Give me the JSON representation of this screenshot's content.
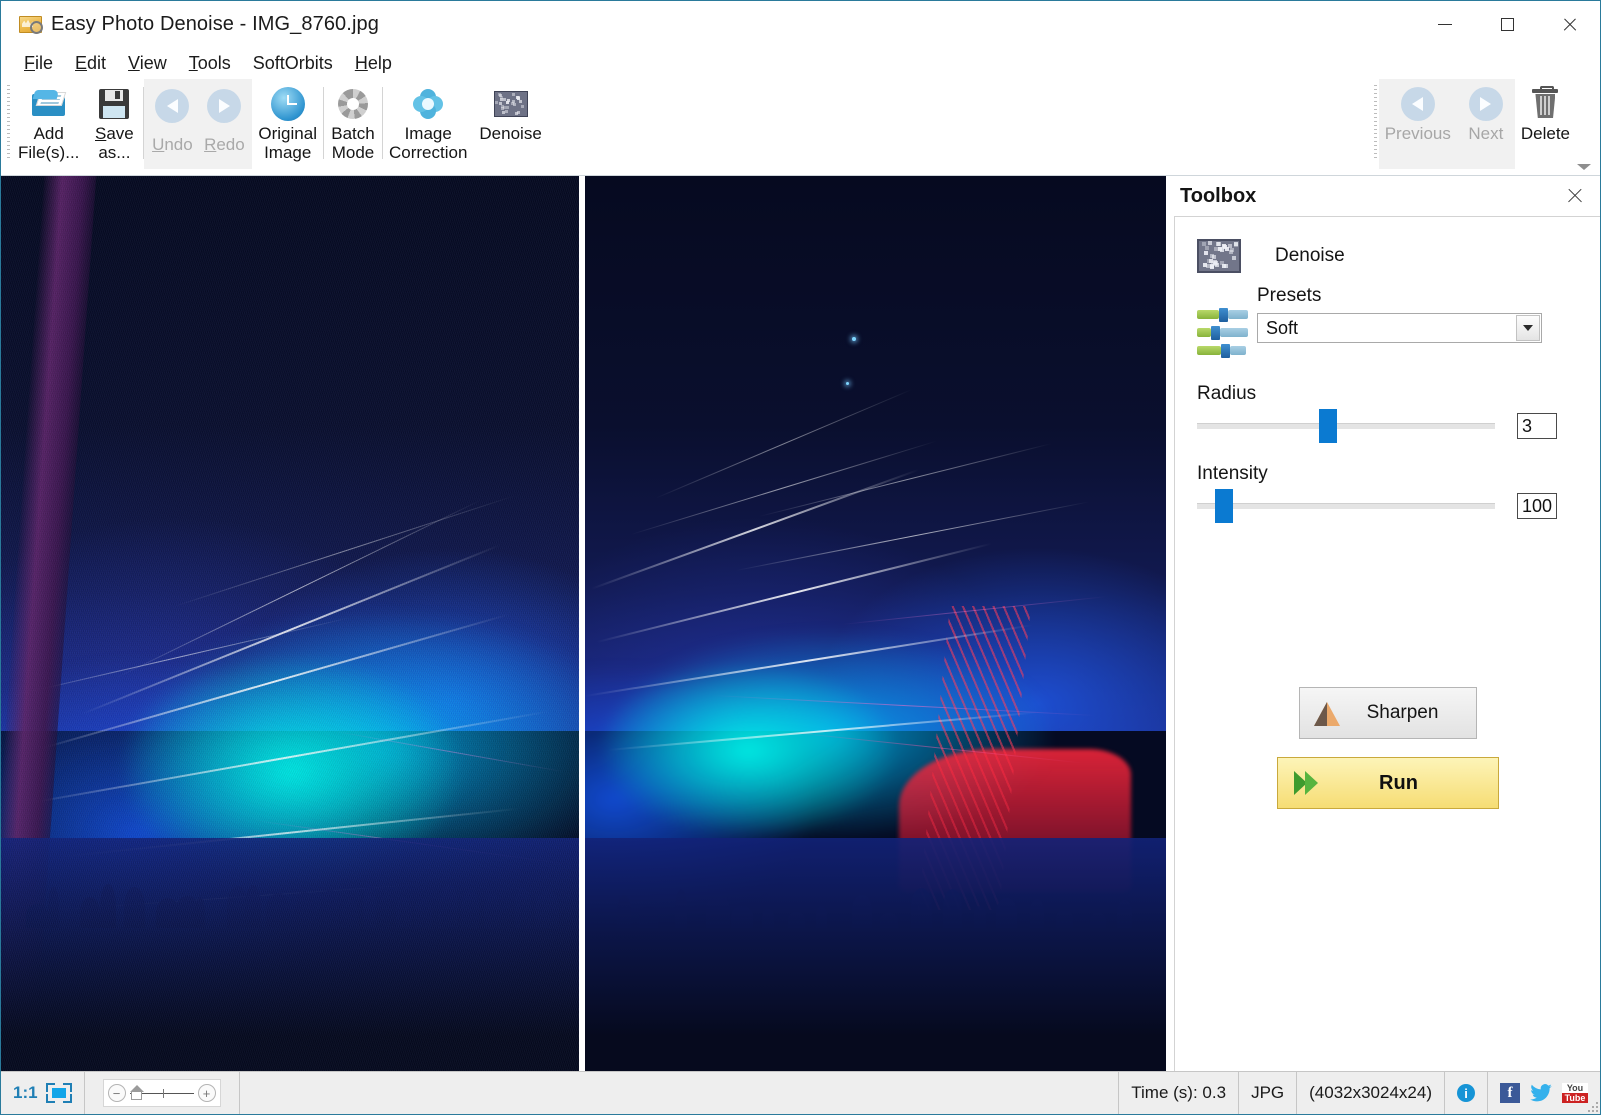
{
  "window": {
    "title": "Easy Photo Denoise - IMG_8760.jpg",
    "app_icon": "photo-frame-icon",
    "minimize": "minimize",
    "maximize": "maximize",
    "close": "close"
  },
  "menu": {
    "items": [
      {
        "label": "File",
        "accel": "F"
      },
      {
        "label": "Edit",
        "accel": "E"
      },
      {
        "label": "View",
        "accel": "V"
      },
      {
        "label": "Tools",
        "accel": "T"
      },
      {
        "label": "SoftOrbits",
        "accel": ""
      },
      {
        "label": "Help",
        "accel": "H"
      }
    ]
  },
  "toolbar": {
    "add_files": "Add\nFile(s)...",
    "save_as": "Save\nas...",
    "undo": "Undo",
    "redo": "Redo",
    "original_image": "Original\nImage",
    "batch_mode": "Batch\nMode",
    "image_correction": "Image\nCorrection",
    "denoise": "Denoise",
    "previous": "Previous",
    "next": "Next",
    "delete": "Delete",
    "overflow": "more-commands"
  },
  "toolbox": {
    "title": "Toolbox",
    "tool_name": "Denoise",
    "presets_label": "Presets",
    "preset_value": "Soft",
    "preset_options": [
      "Soft"
    ],
    "radius_label": "Radius",
    "radius_value": "3",
    "radius_percent": 41,
    "intensity_label": "Intensity",
    "intensity_value": "100",
    "intensity_percent": 6,
    "sharpen_button": "Sharpen",
    "run_button": "Run"
  },
  "statusbar": {
    "zoom_ratio": "1:1",
    "fit_icon": "fit-to-window-icon",
    "zoom_out": "−",
    "zoom_in": "+",
    "time": "Time (s): 0.3",
    "format": "JPG",
    "dimensions": "(4032x3024x24)",
    "info_icon": "i",
    "facebook": "f",
    "twitter": "twitter-icon",
    "youtube_top": "You",
    "youtube_bottom": "Tube"
  },
  "colors": {
    "accent_blue": "#0b7ad1",
    "run_yellow": "#f6dd74",
    "title_border": "#2a7a9b",
    "status_bg": "#eeeeee"
  },
  "image_panes": {
    "left_label": "original-noisy-preview",
    "right_label": "denoised-preview"
  }
}
